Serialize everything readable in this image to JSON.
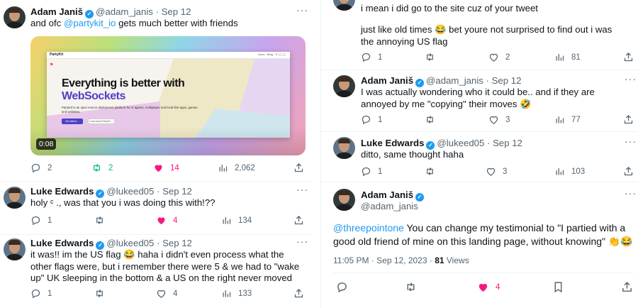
{
  "left": {
    "tweet1": {
      "name": "Adam Janiš",
      "handle": "@adam_janis",
      "date": "· Sep 12",
      "text_pre": "and ofc ",
      "mention": "@partykit_io",
      "text_post": " gets much better with friends",
      "media": {
        "brand": "PartyKit",
        "nav": "Docs · Blog · ✕ ◯ ◯",
        "hero_line1": "Everything is better with",
        "hero_line2": "WebSockets",
        "desc": "PartyKit is an open source deployment platform for AI agents, multiplayer and local-first apps, games, and websites.",
        "btn1": "Get started →",
        "btn2": "Learn about PartyKit →",
        "duration": "0:08"
      },
      "replies": "2",
      "retweets": "2",
      "likes": "14",
      "views": "2,062"
    },
    "tweet2": {
      "name": "Luke Edwards",
      "handle": "@lukeed05",
      "date": "· Sep 12",
      "text": "holy ᶜ ., was that you i was doing this with!??",
      "replies": "1",
      "retweets": "",
      "likes": "4",
      "views": "134"
    },
    "tweet3": {
      "name": "Luke Edwards",
      "handle": "@lukeed05",
      "date": "· Sep 12",
      "text": "it was!! im the US flag 😂 haha i didn't even process what the other flags were, but i remember there were 5 & we had to \"wake up\" UK sleeping in the bottom & a US on the right never moved",
      "replies": "1",
      "retweets": "",
      "likes": "4",
      "views": "133"
    }
  },
  "right": {
    "tweet0": {
      "line1": "i mean i did go to the site cuz of your tweet",
      "line2": "just like old times 😂 bet youre not surprised to find out i was the annoying US flag",
      "replies": "1",
      "retweets": "",
      "likes": "2",
      "views": "81"
    },
    "tweet1": {
      "name": "Adam Janiš",
      "handle": "@adam_janis",
      "date": "· Sep 12",
      "text": "I was actually wondering who it could be.. and if they are annoyed by me \"copying\" their moves 🤣",
      "replies": "1",
      "retweets": "",
      "likes": "3",
      "views": "77"
    },
    "tweet2": {
      "name": "Luke Edwards",
      "handle": "@lukeed05",
      "date": "· Sep 12",
      "text": "ditto, same thought haha",
      "replies": "1",
      "retweets": "",
      "likes": "3",
      "views": "103"
    },
    "main": {
      "name": "Adam Janiš",
      "handle": "@adam_janis",
      "mention": "@threepointone",
      "text": " You can change my testimonial to \"I partied with a good old friend of mine on this landing page, without knowing\" 👏😂",
      "time": "11:05 PM · Sep 12, 2023 · ",
      "views_count": "81",
      "views_label": " Views",
      "likes": "4"
    }
  },
  "colors": {
    "link": "#1d9bf0",
    "like": "#f91880",
    "retweet": "#00ba7c",
    "muted": "#536471"
  },
  "icons": [
    "verified-badge-icon",
    "more-icon",
    "reply-icon",
    "retweet-icon",
    "like-icon",
    "views-icon",
    "share-icon",
    "bookmark-icon"
  ]
}
